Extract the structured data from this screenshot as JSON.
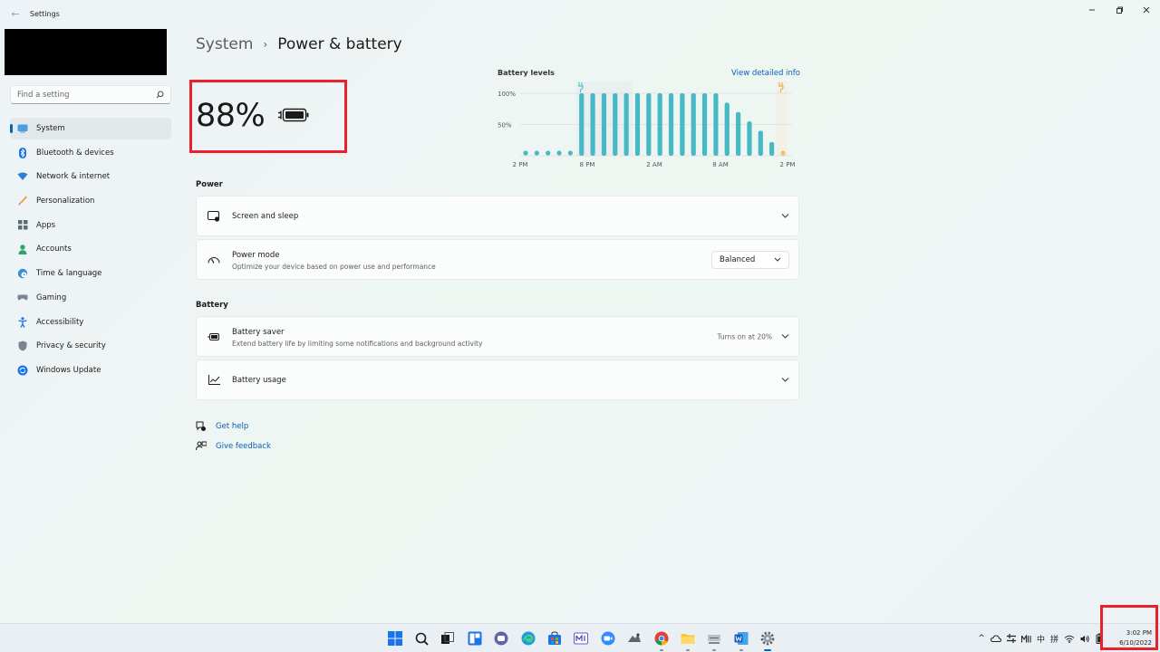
{
  "window": {
    "title": "Settings"
  },
  "search": {
    "placeholder": "Find a setting"
  },
  "sidebar": {
    "items": [
      {
        "label": "System",
        "icon": "monitor-icon",
        "active": true
      },
      {
        "label": "Bluetooth & devices",
        "icon": "bluetooth-icon"
      },
      {
        "label": "Network & internet",
        "icon": "wifi-icon"
      },
      {
        "label": "Personalization",
        "icon": "brush-icon"
      },
      {
        "label": "Apps",
        "icon": "apps-icon"
      },
      {
        "label": "Accounts",
        "icon": "person-icon"
      },
      {
        "label": "Time & language",
        "icon": "globe-clock-icon"
      },
      {
        "label": "Gaming",
        "icon": "gamepad-icon"
      },
      {
        "label": "Accessibility",
        "icon": "accessibility-icon"
      },
      {
        "label": "Privacy & security",
        "icon": "shield-icon"
      },
      {
        "label": "Windows Update",
        "icon": "update-icon"
      }
    ]
  },
  "breadcrumb": {
    "parent": "System",
    "separator": "›",
    "current": "Power & battery"
  },
  "battery": {
    "percent_label": "88%",
    "level": 0.88,
    "charging": true
  },
  "chart_data": {
    "type": "bar",
    "title": "Battery levels",
    "link": "View detailed info",
    "y_ticks": [
      "100%",
      "50%"
    ],
    "x_ticks": [
      "2 PM",
      "8 PM",
      "2 AM",
      "8 AM",
      "2 PM"
    ],
    "ylim": [
      0,
      100
    ],
    "values": [
      4,
      4,
      4,
      4,
      4,
      100,
      100,
      100,
      100,
      100,
      100,
      100,
      100,
      100,
      100,
      100,
      100,
      100,
      85,
      70,
      55,
      40,
      22,
      4
    ],
    "charging_markers": [
      "plug-icon",
      "plug-icon"
    ],
    "colors": {
      "bar": "#47b8c6",
      "dot": "#47b8c6",
      "grid": "#dcdcdc",
      "highlight": "#e8ecec"
    }
  },
  "power": {
    "section_title": "Power",
    "screen_sleep": {
      "title": "Screen and sleep"
    },
    "power_mode": {
      "title": "Power mode",
      "subtitle": "Optimize your device based on power use and performance",
      "value": "Balanced"
    }
  },
  "battery_section": {
    "section_title": "Battery",
    "saver": {
      "title": "Battery saver",
      "subtitle": "Extend battery life by limiting some notifications and background activity",
      "status": "Turns on at 20%"
    },
    "usage": {
      "title": "Battery usage"
    }
  },
  "help": {
    "get_help": "Get help",
    "give_feedback": "Give feedback"
  },
  "taskbar": {
    "apps": [
      "windows-start-icon",
      "search-icon",
      "task-view-icon",
      "widgets-icon",
      "teams-chat-icon",
      "edge-icon",
      "store-icon",
      "mail-app-icon",
      "zoom-icon",
      "game-icon",
      "chrome-icon",
      "file-explorer-icon",
      "network-drive-icon",
      "word-icon",
      "settings-gear-icon"
    ],
    "tray": [
      "^",
      "中",
      "拼"
    ],
    "time": "3:02 PM",
    "date": "6/10/2022"
  },
  "colors": {
    "accent": "#0067c0",
    "highlight_box": "#e8212b"
  }
}
